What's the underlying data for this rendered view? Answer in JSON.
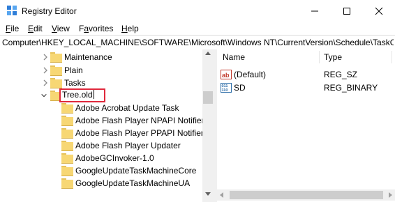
{
  "window": {
    "title": "Registry Editor"
  },
  "menu": [
    "File",
    "Edit",
    "View",
    "Favorites",
    "Help"
  ],
  "menu_underlines": [
    "F",
    "E",
    "V",
    "a",
    "H"
  ],
  "address": "Computer\\HKEY_LOCAL_MACHINE\\SOFTWARE\\Microsoft\\Windows NT\\CurrentVersion\\Schedule\\TaskCa",
  "tree": {
    "siblings": [
      "Maintenance",
      "Plain",
      "Tasks"
    ],
    "renaming": {
      "value": "Tree.old"
    },
    "children": [
      "Adobe Acrobat Update Task",
      "Adobe Flash Player NPAPI Notifier",
      "Adobe Flash Player PPAPI Notifier",
      "Adobe Flash Player Updater",
      "AdobeGCInvoker-1.0",
      "GoogleUpdateTaskMachineCore",
      "GoogleUpdateTaskMachineUA"
    ]
  },
  "values_pane": {
    "columns": {
      "name": "Name",
      "type": "Type"
    },
    "rows": [
      {
        "name": "(Default)",
        "type": "REG_SZ",
        "icon": "string-value-icon"
      },
      {
        "name": "SD",
        "type": "REG_BINARY",
        "icon": "binary-value-icon"
      }
    ]
  },
  "colors": {
    "rename_border": "#e0283c",
    "folder": "#f7d774"
  }
}
